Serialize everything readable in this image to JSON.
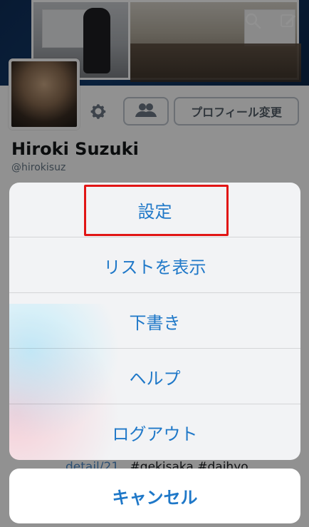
{
  "header": {
    "icons": {
      "search": "search-icon",
      "compose": "compose-icon"
    }
  },
  "profile": {
    "name": "Hiroki Suzuki",
    "handle": "@hirokisuz",
    "buttons": {
      "settings_icon": "gear-icon",
      "people_icon": "people-icon",
      "edit_profile_label": "プロフィール変更"
    }
  },
  "background": {
    "link_text": "detail/21",
    "hashtags": "#gekisaka #daihyo"
  },
  "action_sheet": {
    "items": [
      {
        "label": "設定"
      },
      {
        "label": "リストを表示"
      },
      {
        "label": "下書き"
      },
      {
        "label": "ヘルプ"
      },
      {
        "label": "ログアウト"
      }
    ],
    "cancel_label": "キャンセル"
  },
  "colors": {
    "accent_blue": "#1f78c8",
    "highlight_red": "#e11515"
  }
}
